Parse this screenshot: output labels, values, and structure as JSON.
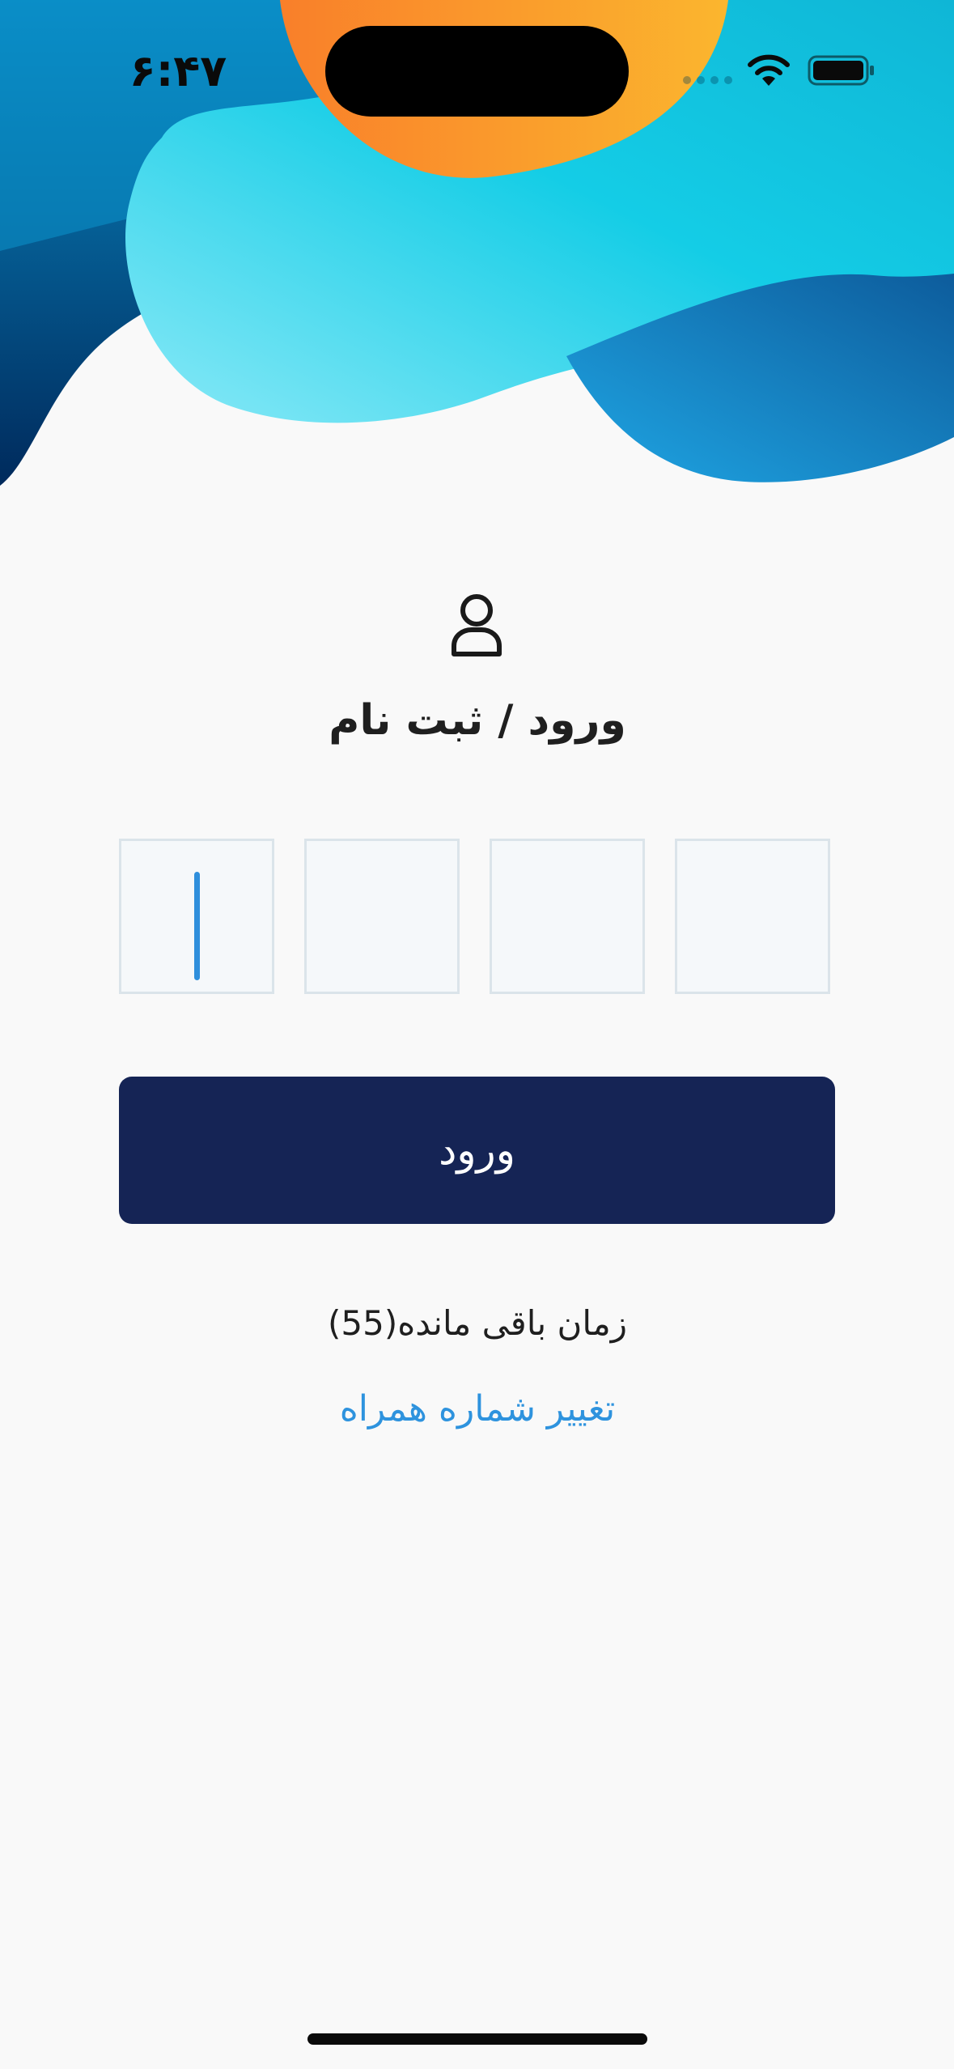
{
  "status_bar": {
    "time": "۶:۴۷"
  },
  "login": {
    "title": "ورود / ثبت نام",
    "otp_digits": [
      "",
      "",
      "",
      ""
    ],
    "submit_label": "ورود",
    "timer_text": "زمان باقی مانده(55)",
    "change_number_label": "تغییر شماره همراه"
  },
  "colors": {
    "primary_button": "#152455",
    "link": "#2e93de",
    "cursor": "#2e8fdc"
  },
  "icons": {
    "user": "user-icon",
    "wifi": "wifi-icon",
    "battery": "battery-icon"
  }
}
